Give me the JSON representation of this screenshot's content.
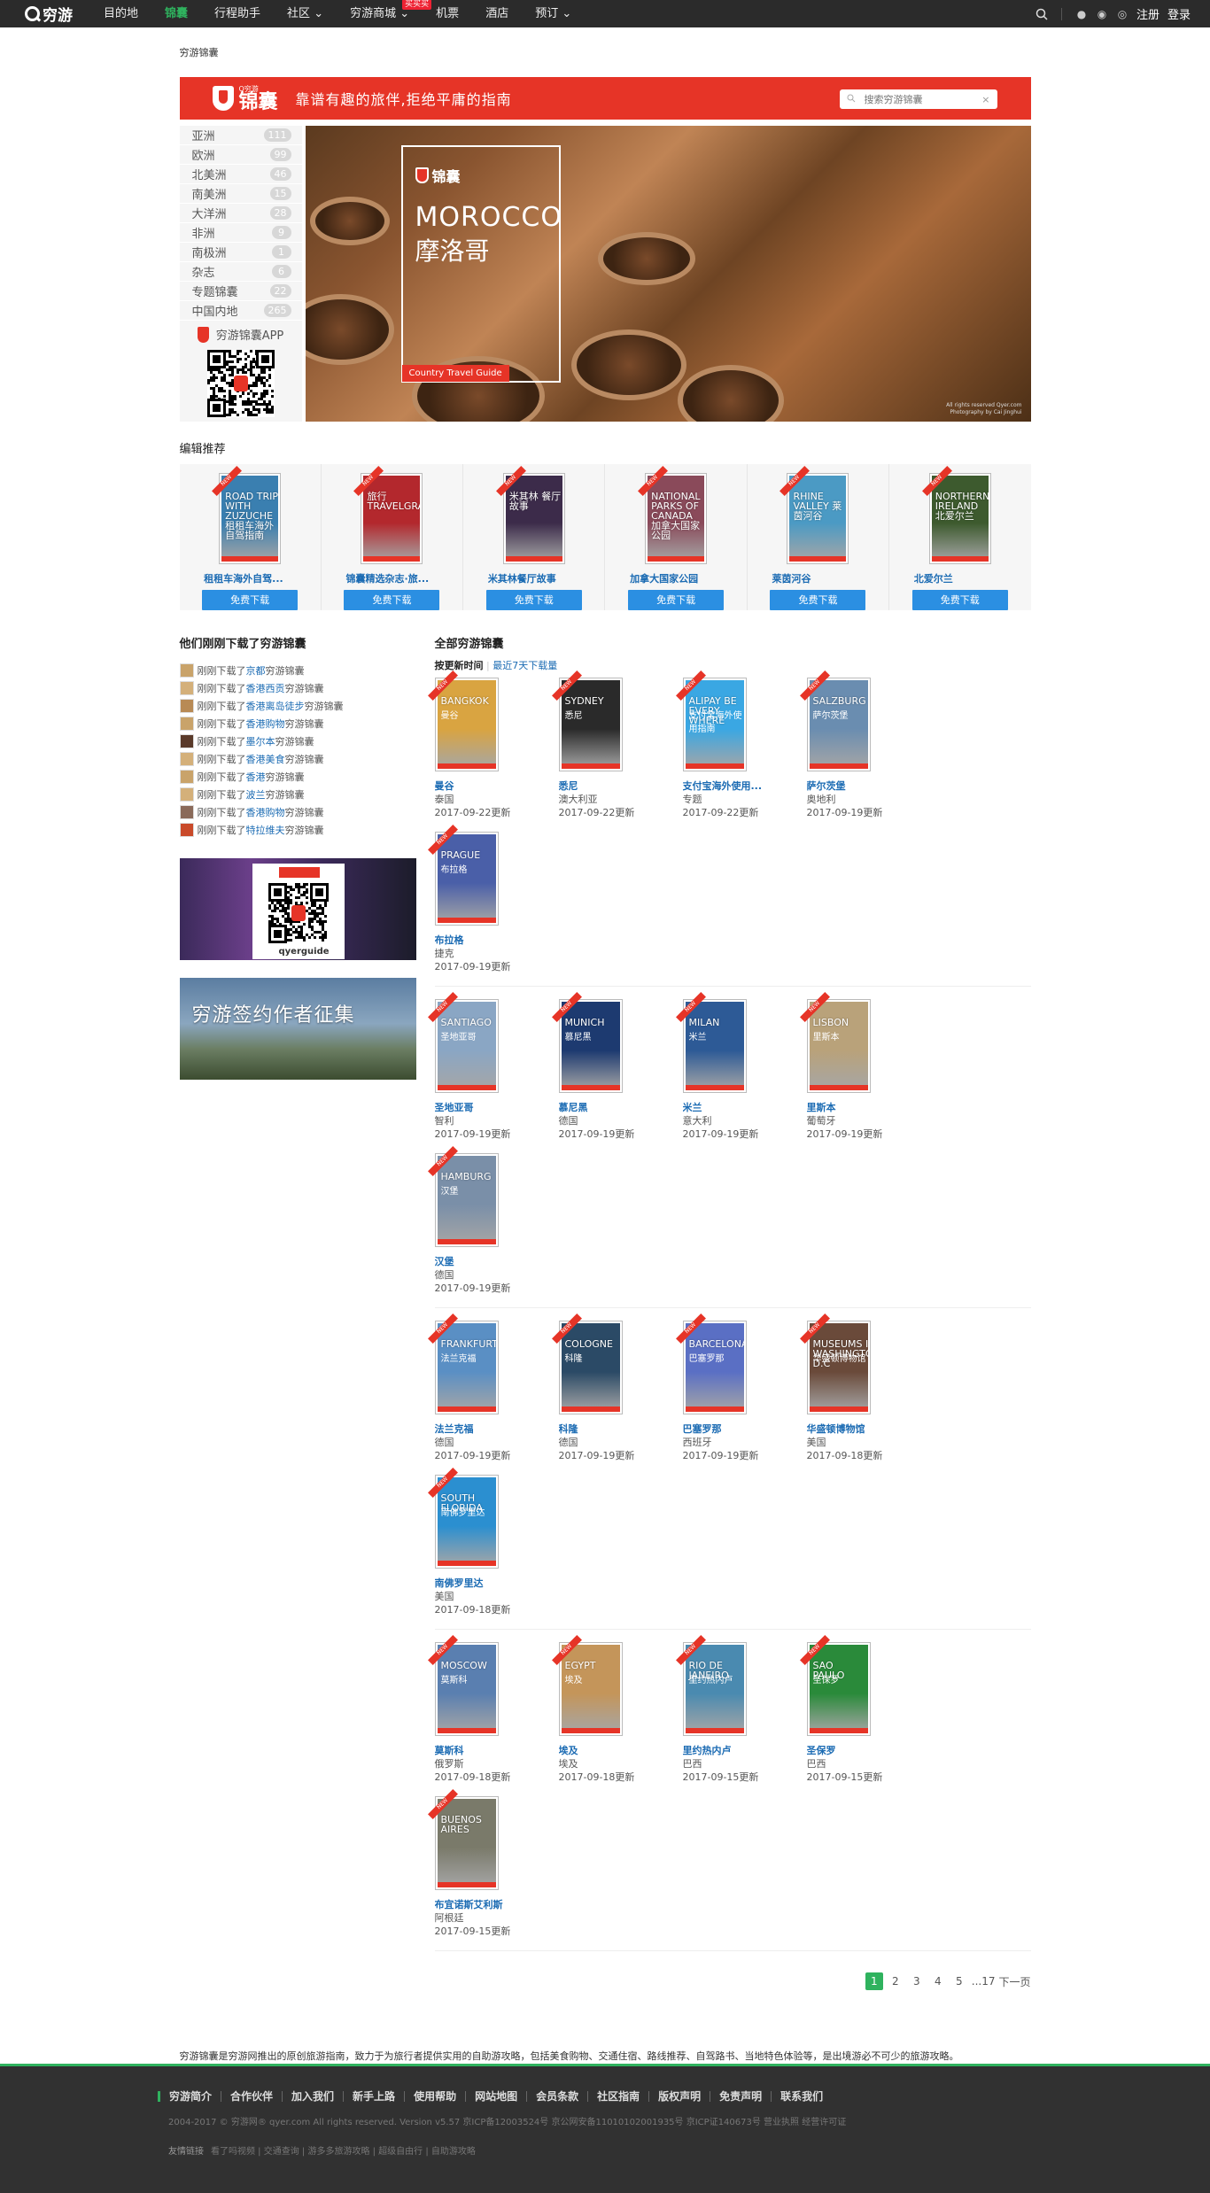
{
  "nav": {
    "logo": "穷游",
    "items": [
      "目的地",
      "锦囊",
      "行程助手",
      "社区",
      "穷游商城",
      "机票",
      "酒店",
      "预订"
    ],
    "badge": "买买买",
    "register": "注册",
    "login": "登录"
  },
  "breadcrumb": "穷游锦囊",
  "banner": {
    "brand": "锦囊",
    "brand_small": "Q穷游",
    "slogan": "靠谱有趣的旅伴,拒绝平庸的指南",
    "search_placeholder": "搜索穷游锦囊",
    "clear": "×"
  },
  "sidebar": {
    "items": [
      {
        "label": "亚洲",
        "count": "111"
      },
      {
        "label": "欧洲",
        "count": "99"
      },
      {
        "label": "北美洲",
        "count": "46"
      },
      {
        "label": "南美洲",
        "count": "15"
      },
      {
        "label": "大洋洲",
        "count": "28"
      },
      {
        "label": "非洲",
        "count": "9"
      },
      {
        "label": "南极洲",
        "count": "1"
      },
      {
        "label": "杂志",
        "count": "6"
      },
      {
        "label": "专题锦囊",
        "count": "22"
      },
      {
        "label": "中国内地",
        "count": "265"
      }
    ],
    "app_label": "穷游锦囊APP"
  },
  "hero": {
    "logo": "锦囊",
    "title_en": "MOROCCO",
    "title_cn": "摩洛哥",
    "tag": "Country Travel Guide",
    "credit1": "All rights reserved Qyer.com",
    "credit2": "Photography by Cai Jinghui"
  },
  "editors": {
    "title": "编辑推荐",
    "button": "免费下载",
    "items": [
      {
        "name": "租租车海外自驾...",
        "cover": "ROAD TRIP WITH ZUZUCHE 租租车海外自驾指南",
        "color": "#3a7fb0"
      },
      {
        "name": "锦囊精选杂志·旅...",
        "cover": "旅行 TRAVELGRAPHY",
        "color": "#b3282d"
      },
      {
        "name": "米其林餐厅故事",
        "cover": "米其林 餐厅故事",
        "color": "#3c2b4a"
      },
      {
        "name": "加拿大国家公园",
        "cover": "NATIONAL PARKS OF CANADA 加拿大国家公园",
        "color": "#8a4a5a"
      },
      {
        "name": "莱茵河谷",
        "cover": "RHINE VALLEY 莱茵河谷",
        "color": "#4b9ac4"
      },
      {
        "name": "北爱尔兰",
        "cover": "NORTHERN IRELAND 北爱尔兰",
        "color": "#3d5a2e"
      }
    ]
  },
  "downloads": {
    "title": "他们刚刚下载了穷游锦囊",
    "prefix": "刚刚下载了",
    "suffix": "穷游锦囊",
    "items": [
      "京都",
      "香港西贡",
      "香港离岛徒步",
      "香港购物",
      "墨尔本",
      "香港美食",
      "香港",
      "波兰",
      "香港购物",
      "特拉维夫"
    ]
  },
  "promo": {
    "qr_label": "qyerguide",
    "writer": "穷游签约作者征集"
  },
  "all": {
    "title": "全部穷游锦囊",
    "sort_active": "按更新时间",
    "sort_link": "最近7天下载量",
    "items": [
      {
        "title": "曼谷",
        "country": "泰国",
        "date": "2017-09-22更新",
        "en": "BANGKOK",
        "cn": "曼谷",
        "color": "#d9a441"
      },
      {
        "title": "悉尼",
        "country": "澳大利亚",
        "date": "2017-09-22更新",
        "en": "SYDNEY",
        "cn": "悉尼",
        "color": "#2a2a2a"
      },
      {
        "title": "支付宝海外使用...",
        "country": "专题",
        "date": "2017-09-22更新",
        "en": "ALIPAY BE EVERY WHERE",
        "cn": "支付宝海外使用指南",
        "color": "#3aa7e3"
      },
      {
        "title": "萨尔茨堡",
        "country": "奥地利",
        "date": "2017-09-19更新",
        "en": "SALZBURG",
        "cn": "萨尔茨堡",
        "color": "#6a8db0"
      },
      {
        "title": "布拉格",
        "country": "捷克",
        "date": "2017-09-19更新",
        "en": "PRAGUE",
        "cn": "布拉格",
        "color": "#4a5fa8"
      },
      {
        "title": "圣地亚哥",
        "country": "智利",
        "date": "2017-09-19更新",
        "en": "SANTIAGO",
        "cn": "圣地亚哥",
        "color": "#8aa6c4"
      },
      {
        "title": "慕尼黑",
        "country": "德国",
        "date": "2017-09-19更新",
        "en": "MUNICH",
        "cn": "慕尼黑",
        "color": "#1d3a70"
      },
      {
        "title": "米兰",
        "country": "意大利",
        "date": "2017-09-19更新",
        "en": "MILAN",
        "cn": "米兰",
        "color": "#2d5a96"
      },
      {
        "title": "里斯本",
        "country": "葡萄牙",
        "date": "2017-09-19更新",
        "en": "LISBON",
        "cn": "里斯本",
        "color": "#b9a27a"
      },
      {
        "title": "汉堡",
        "country": "德国",
        "date": "2017-09-19更新",
        "en": "HAMBURG",
        "cn": "汉堡",
        "color": "#7a8fa8"
      },
      {
        "title": "法兰克福",
        "country": "德国",
        "date": "2017-09-19更新",
        "en": "FRANKFURT",
        "cn": "法兰克福",
        "color": "#5a8fc4"
      },
      {
        "title": "科隆",
        "country": "德国",
        "date": "2017-09-19更新",
        "en": "COLOGNE",
        "cn": "科隆",
        "color": "#2b4a66"
      },
      {
        "title": "巴塞罗那",
        "country": "西班牙",
        "date": "2017-09-19更新",
        "en": "BARCELONA",
        "cn": "巴塞罗那",
        "color": "#5a6fc4"
      },
      {
        "title": "华盛顿博物馆",
        "country": "美国",
        "date": "2017-09-18更新",
        "en": "MUSEUMS IN WASHINGTON D.C",
        "cn": "华盛顿博物馆",
        "color": "#6a4a3a"
      },
      {
        "title": "南佛罗里达",
        "country": "美国",
        "date": "2017-09-18更新",
        "en": "SOUTH FLORIDA",
        "cn": "南佛罗里达",
        "color": "#2b8fd0"
      },
      {
        "title": "莫斯科",
        "country": "俄罗斯",
        "date": "2017-09-18更新",
        "en": "MOSCOW",
        "cn": "莫斯科",
        "color": "#5a7fb0"
      },
      {
        "title": "埃及",
        "country": "埃及",
        "date": "2017-09-18更新",
        "en": "EGYPT",
        "cn": "埃及",
        "color": "#c4955a"
      },
      {
        "title": "里约热内卢",
        "country": "巴西",
        "date": "2017-09-15更新",
        "en": "RIO DE JANEIRO",
        "cn": "里约热内卢",
        "color": "#4a8ab0"
      },
      {
        "title": "圣保罗",
        "country": "巴西",
        "date": "2017-09-15更新",
        "en": "SAO PAULO",
        "cn": "圣保罗",
        "color": "#2a8a3a"
      },
      {
        "title": "布宜诺斯艾利斯",
        "country": "阿根廷",
        "date": "2017-09-15更新",
        "en": "BUENOS AIRES",
        "cn": "",
        "color": "#7a7a6a"
      }
    ]
  },
  "pager": {
    "pages": [
      "1",
      "2",
      "3",
      "4",
      "5"
    ],
    "ellipsis": "...17",
    "next": "下一页"
  },
  "intro": "穷游锦囊是穷游网推出的原创旅游指南，致力于为旅行者提供实用的自助游攻略，包括美食购物、交通住宿、路线推荐、自驾路书、当地特色体验等，是出境游必不可少的旅游攻略。",
  "footer": {
    "links": [
      "穷游简介",
      "合作伙伴",
      "加入我们",
      "新手上路",
      "使用帮助",
      "网站地图",
      "会员条款",
      "社区指南",
      "版权声明",
      "免责声明",
      "联系我们"
    ],
    "copyright": "2004-2017 © 穷游网® qyer.com All rights reserved. Version v5.57  京ICP备12003524号  京公网安备11010102001935号  京ICP证140673号  营业执照 经营许可证",
    "friend_label": "友情链接",
    "friends": "看了吗视频 | 交通查询 | 游多多旅游攻略 | 超级自由行 | 自助游攻略"
  },
  "colors": {
    "accent": "#2fb25e",
    "brand_red": "#e63427",
    "link": "#1b6bb3",
    "button": "#2b8fe2"
  }
}
